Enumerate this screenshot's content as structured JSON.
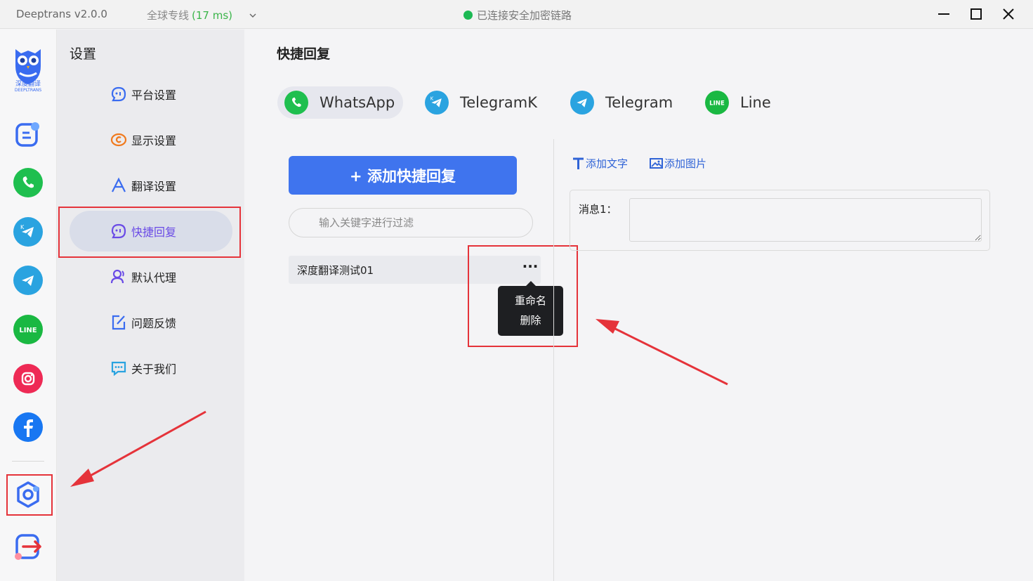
{
  "titlebar": {
    "app_version": "Deeptrans v2.0.0",
    "line_name": "全球专线",
    "line_latency": "(17 ms)",
    "connection_status": "已连接安全加密链路",
    "status_color": "#1db954"
  },
  "rail": {
    "logo_text": "深度翻译",
    "logo_sub": "DEEPLTRANS",
    "items": [
      {
        "icon": "notes-icon"
      },
      {
        "icon": "whatsapp-icon"
      },
      {
        "icon": "telegramk-icon"
      },
      {
        "icon": "telegram-icon"
      },
      {
        "icon": "line-icon"
      },
      {
        "icon": "instagram-icon"
      },
      {
        "icon": "facebook-icon"
      },
      {
        "icon": "settings-icon"
      },
      {
        "icon": "logout-icon"
      }
    ]
  },
  "menu": {
    "title": "设置",
    "items": [
      {
        "label": "平台设置",
        "icon": "platform-chat-icon"
      },
      {
        "label": "显示设置",
        "icon": "display-icon"
      },
      {
        "label": "翻译设置",
        "icon": "translate-icon"
      },
      {
        "label": "快捷回复",
        "icon": "quick-reply-icon",
        "active": true
      },
      {
        "label": "默认代理",
        "icon": "proxy-user-icon"
      },
      {
        "label": "问题反馈",
        "icon": "feedback-icon"
      },
      {
        "label": "关于我们",
        "icon": "about-icon"
      }
    ]
  },
  "main": {
    "title": "快捷回复",
    "tabs": [
      {
        "label": "WhatsApp",
        "icon": "whatsapp-icon",
        "active": true
      },
      {
        "label": "TelegramK",
        "icon": "telegramk-icon"
      },
      {
        "label": "Telegram",
        "icon": "telegram-icon"
      },
      {
        "label": "Line",
        "icon": "line-icon"
      }
    ],
    "add_button": "+ 添加快捷回复",
    "filter_placeholder": "输入关键字进行过滤",
    "reply_items": [
      {
        "label": "深度翻译测试01"
      }
    ],
    "more_label": "···",
    "popup_menu": [
      "重命名",
      "删除"
    ],
    "add_text": "添加文字",
    "add_image": "添加图片",
    "message_label": "消息1："
  },
  "colors": {
    "accent": "#3f74ee",
    "active_menu_text": "#6a4be6",
    "annotation_red": "#e5333a",
    "whatsapp": "#1fbf4f",
    "telegram": "#2aa3e0",
    "line": "#1ab842"
  }
}
